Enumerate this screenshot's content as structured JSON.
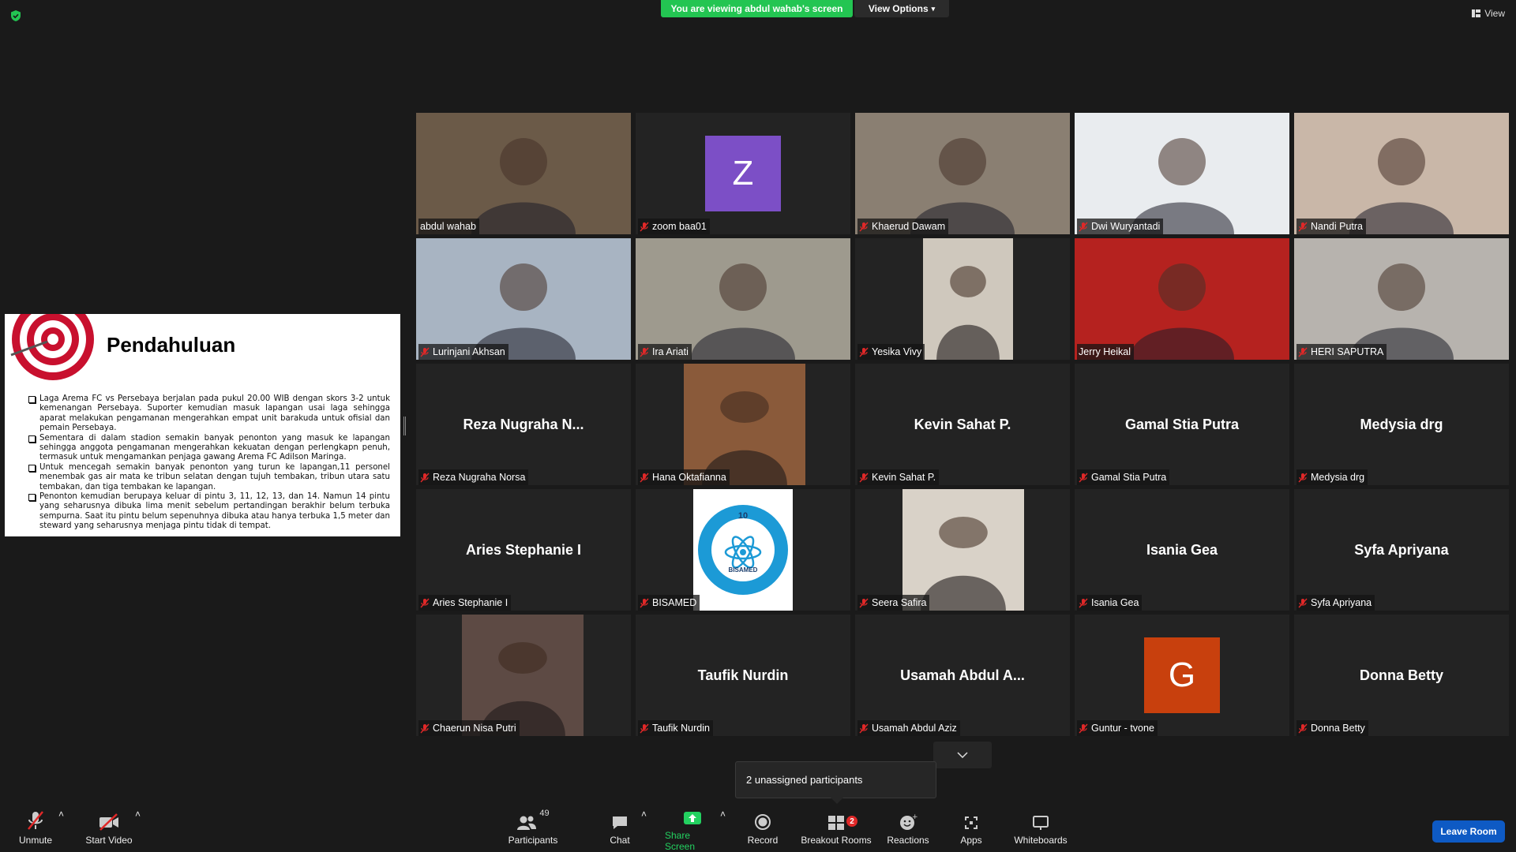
{
  "banner": {
    "viewing_text": "You are viewing abdul wahab's screen",
    "view_options_label": "View Options",
    "view_label": "View"
  },
  "slide": {
    "title": "Pendahuluan",
    "bullets": [
      "Laga Arema FC vs Persebaya berjalan pada pukul 20.00 WIB dengan skors 3-2 untuk kemenangan Persebaya. Suporter kemudian masuk lapangan usai laga sehingga aparat melakukan pengamanan mengerahkan empat unit barakuda untuk ofisial dan pemain Persebaya.",
      "Sementara di dalam stadion semakin banyak penonton yang masuk ke lapangan sehingga anggota pengamanan mengerahkan kekuatan dengan perlengkapn penuh, termasuk untuk mengamankan penjaga gawang Arema FC Adilson Maringa.",
      "Untuk mencegah semakin banyak penonton yang turun ke lapangan,11 personel menembak gas air mata ke tribun selatan dengan tujuh tembakan, tribun utara satu tembakan, dan tiga tembakan ke lapangan.",
      "Penonton kemudian berupaya keluar di pintu 3, 11, 12, 13, dan 14. Namun 14 pintu yang seharusnya dibuka lima menit sebelum pertandingan berakhir belum terbuka sempurna. Saat itu pintu belum sepenuhnya dibuka atau hanya terbuka 1,5 meter dan steward yang seharusnya menjaga pintu tidak di tempat."
    ]
  },
  "participants": [
    {
      "name": "abdul wahab",
      "kind": "video",
      "muted": false,
      "active": true,
      "bg": "#6b5a48"
    },
    {
      "name": "zoom baa01",
      "kind": "letter",
      "letter": "Z",
      "letter_bg": "#7c4fc6",
      "muted": true
    },
    {
      "name": "Khaerud Dawam",
      "kind": "video",
      "muted": true,
      "bg": "#8a7f72"
    },
    {
      "name": "Dwi Wuryantadi",
      "kind": "video",
      "muted": true,
      "bg": "#e9ecef"
    },
    {
      "name": "Nandi Putra",
      "kind": "video",
      "muted": true,
      "bg": "#c9b7a8"
    },
    {
      "name": "Lurinjani Akhsan",
      "kind": "video",
      "muted": true,
      "bg": "#a8b4c2"
    },
    {
      "name": "Ira Ariati",
      "kind": "video",
      "muted": true,
      "bg": "#9e9a8e"
    },
    {
      "name": "Yesika Vivy",
      "kind": "portrait",
      "muted": true,
      "bg": "#cfc8bd"
    },
    {
      "name": "Jerry Heikal",
      "kind": "video",
      "muted": false,
      "bg": "#b5221f"
    },
    {
      "name": "HERI SAPUTRA",
      "kind": "video",
      "muted": true,
      "bg": "#b7b3ae"
    },
    {
      "name": "Reza Nugraha Norsa",
      "display": "Reza Nugraha N...",
      "kind": "name",
      "muted": true
    },
    {
      "name": "Hana Oktafianna",
      "kind": "portrait",
      "muted": true,
      "bg": "#8a5a3a"
    },
    {
      "name": "Kevin Sahat P.",
      "display": "Kevin Sahat P.",
      "kind": "name",
      "muted": true
    },
    {
      "name": "Gamal Stia Putra",
      "display": "Gamal Stia Putra",
      "kind": "name",
      "muted": true
    },
    {
      "name": "Medysia drg",
      "display": "Medysia drg",
      "kind": "name",
      "muted": true
    },
    {
      "name": "Aries Stephanie I",
      "display": "Aries Stephanie I",
      "kind": "name",
      "muted": true
    },
    {
      "name": "BISAMED",
      "kind": "logo",
      "muted": true,
      "logo_text": "10",
      "logo_caption": "BISAMED"
    },
    {
      "name": "Seera Safira",
      "kind": "portrait",
      "muted": true,
      "bg": "#d9d2c8"
    },
    {
      "name": "Isania Gea",
      "display": "Isania Gea",
      "kind": "name",
      "muted": true
    },
    {
      "name": "Syfa Apriyana",
      "display": "Syfa Apriyana",
      "kind": "name",
      "muted": true
    },
    {
      "name": "Chaerun Nisa Putri",
      "kind": "portrait",
      "muted": true,
      "bg": "#5d4a44"
    },
    {
      "name": "Taufik Nurdin",
      "display": "Taufik Nurdin",
      "kind": "name",
      "muted": true
    },
    {
      "name": "Usamah Abdul Aziz",
      "display": "Usamah Abdul A...",
      "kind": "name",
      "muted": true
    },
    {
      "name": "Guntur - tvone",
      "kind": "letter",
      "letter": "G",
      "letter_bg": "#c8400d",
      "muted": true
    },
    {
      "name": "Donna Betty",
      "display": "Donna Betty",
      "kind": "name",
      "muted": true
    }
  ],
  "popup": {
    "unassigned_text": "2 unassigned participants"
  },
  "toolbar": {
    "unmute": "Unmute",
    "start_video": "Start Video",
    "participants": "Participants",
    "participants_count": "49",
    "chat": "Chat",
    "share_screen": "Share Screen",
    "record": "Record",
    "breakout_rooms": "Breakout Rooms",
    "breakout_badge": "2",
    "reactions": "Reactions",
    "apps": "Apps",
    "whiteboards": "Whiteboards",
    "leave_room": "Leave Room"
  },
  "colors": {
    "accent_green": "#23c552",
    "active_speaker": "#e9e46c",
    "leave_blue": "#0e5ac4"
  }
}
